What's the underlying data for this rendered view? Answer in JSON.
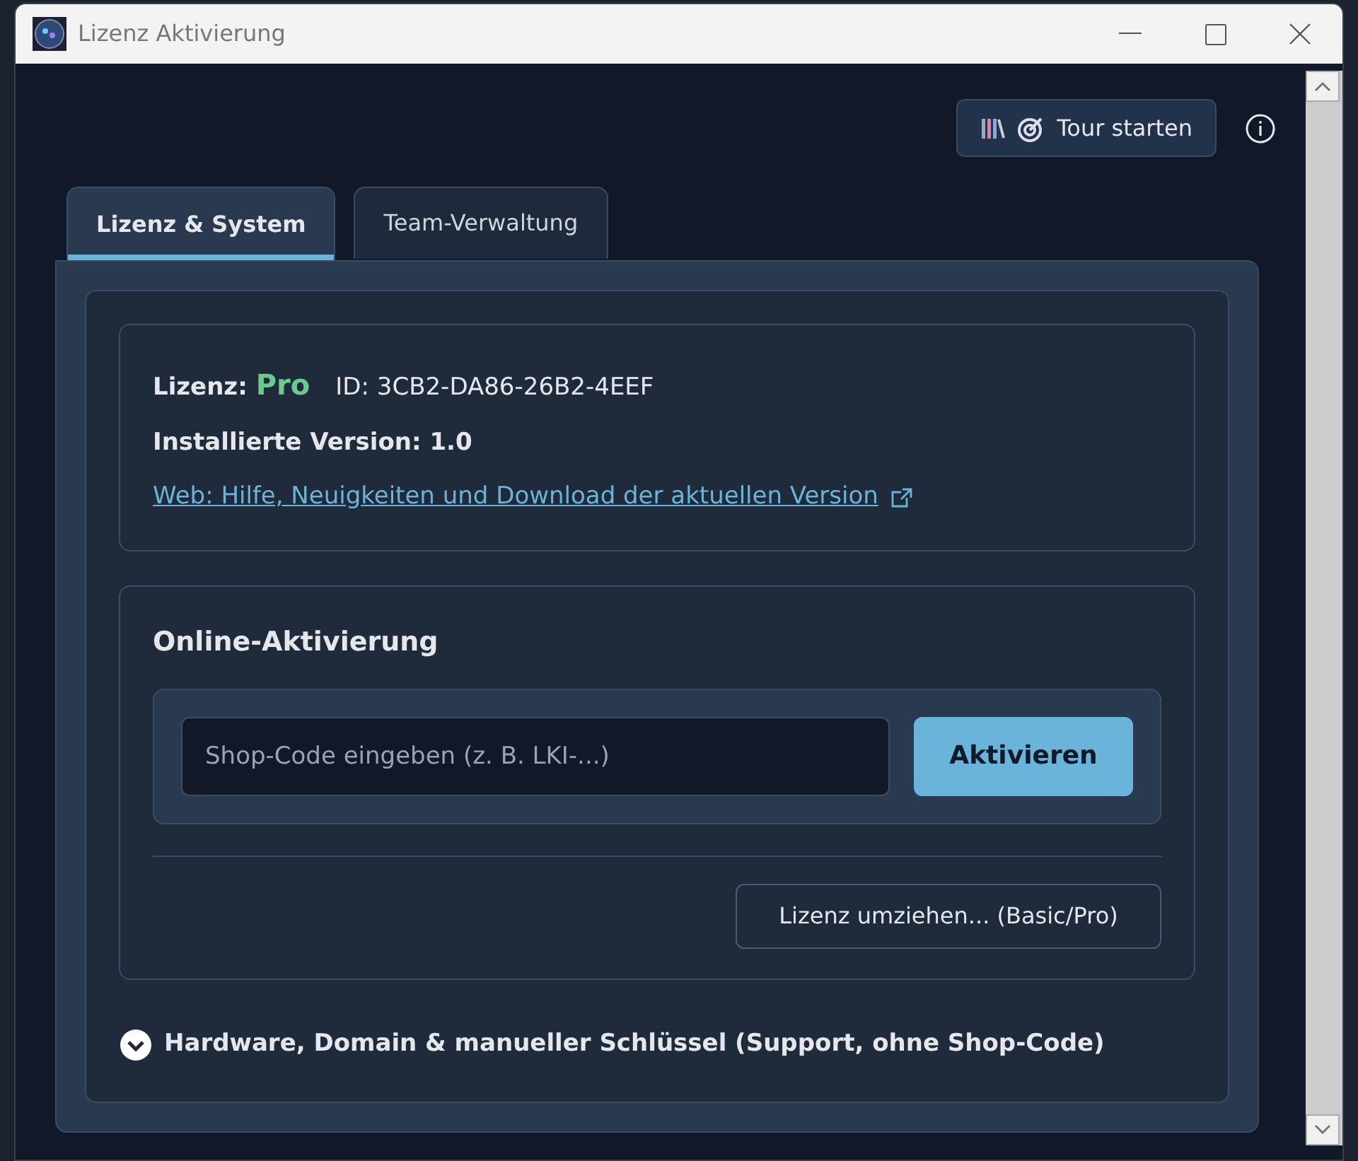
{
  "window": {
    "title": "Lizenz Aktivierung"
  },
  "toolbar": {
    "tour_button": "Tour starten"
  },
  "tabs": [
    {
      "label": "Lizenz & System",
      "selected": true
    },
    {
      "label": "Team-Verwaltung",
      "selected": false
    }
  ],
  "license": {
    "label": "Lizenz:",
    "edition": "Pro",
    "id": "ID: 3CB2-DA86-26B2-4EEF",
    "version": "Installierte Version: 1.0",
    "web_link": "Web: Hilfe, Neuigkeiten und Download der aktuellen Version"
  },
  "activation": {
    "heading": "Online-Aktivierung",
    "placeholder": "Shop-Code eingeben (z. B. LKI-...)",
    "activate_button": "Aktivieren",
    "move_button": "Lizenz umziehen... (Basic/Pro)"
  },
  "details": {
    "label": "Hardware, Domain & manueller Schlüssel (Support, ohne Shop-Code)",
    "expanded": false
  }
}
